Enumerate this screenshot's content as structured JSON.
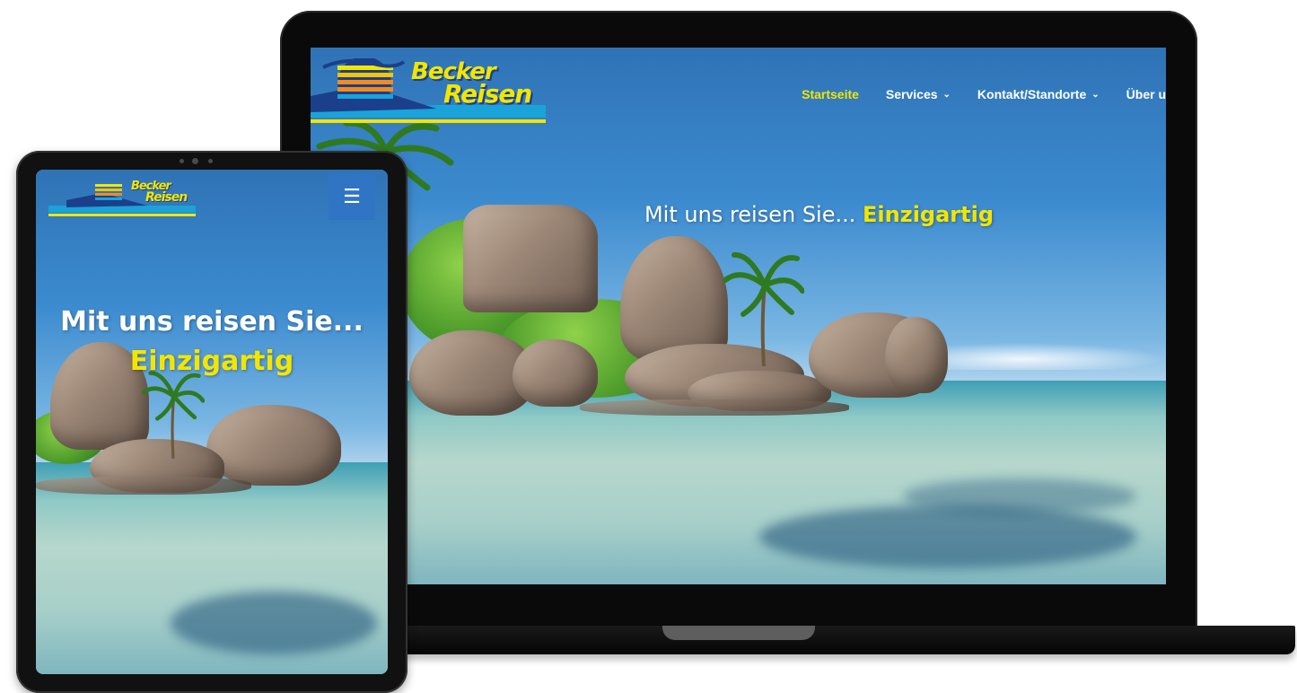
{
  "brand": {
    "name_line1": "Becker",
    "name_line2": "Reisen",
    "logo_colors": [
      "#f2e600",
      "#1b3f8a",
      "#1aa3d8",
      "#f28c1e"
    ]
  },
  "nav": {
    "items": [
      {
        "label": "Startseite",
        "active": true,
        "has_dropdown": false
      },
      {
        "label": "Services",
        "active": false,
        "has_dropdown": true
      },
      {
        "label": "Kontakt/Standorte",
        "active": false,
        "has_dropdown": true
      },
      {
        "label": "Über u",
        "active": false,
        "has_dropdown": false
      }
    ]
  },
  "hero": {
    "headline_main": "Mit uns reisen Sie...",
    "headline_accent": "Einzigartig"
  },
  "mobile": {
    "menu_icon": "hamburger-icon"
  },
  "colors": {
    "accent": "#f2e600",
    "nav_text": "#ffffff",
    "menu_button": "#2f75c4",
    "device_frame": "#0a0a0a"
  }
}
